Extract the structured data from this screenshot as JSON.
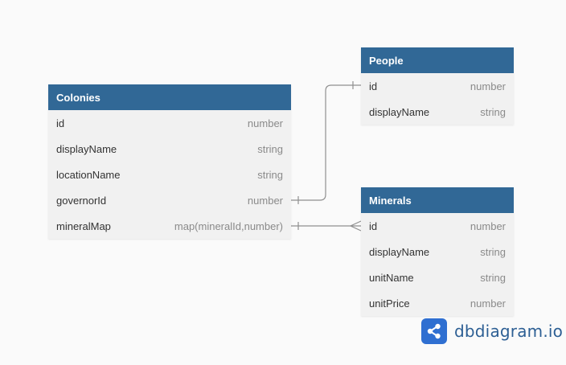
{
  "tables": {
    "colonies": {
      "title": "Colonies",
      "rows": [
        {
          "name": "id",
          "type": "number"
        },
        {
          "name": "displayName",
          "type": "string"
        },
        {
          "name": "locationName",
          "type": "string"
        },
        {
          "name": "governorId",
          "type": "number"
        },
        {
          "name": "mineralMap",
          "type": "map(mineralId,number)"
        }
      ]
    },
    "people": {
      "title": "People",
      "rows": [
        {
          "name": "id",
          "type": "number"
        },
        {
          "name": "displayName",
          "type": "string"
        }
      ]
    },
    "minerals": {
      "title": "Minerals",
      "rows": [
        {
          "name": "id",
          "type": "number"
        },
        {
          "name": "displayName",
          "type": "string"
        },
        {
          "name": "unitName",
          "type": "string"
        },
        {
          "name": "unitPrice",
          "type": "number"
        }
      ]
    }
  },
  "relations": [
    {
      "from": "Colonies.governorId",
      "to": "People.id",
      "from_end": "one",
      "to_end": "one"
    },
    {
      "from": "Colonies.mineralMap",
      "to": "Minerals.id",
      "from_end": "one",
      "to_end": "many"
    }
  ],
  "brand": {
    "name": "dbdiagram.io",
    "icon": "share-nodes-icon",
    "color": "#2f6fd1"
  },
  "colors": {
    "header": "#316896",
    "connector": "#8f8f8f"
  }
}
